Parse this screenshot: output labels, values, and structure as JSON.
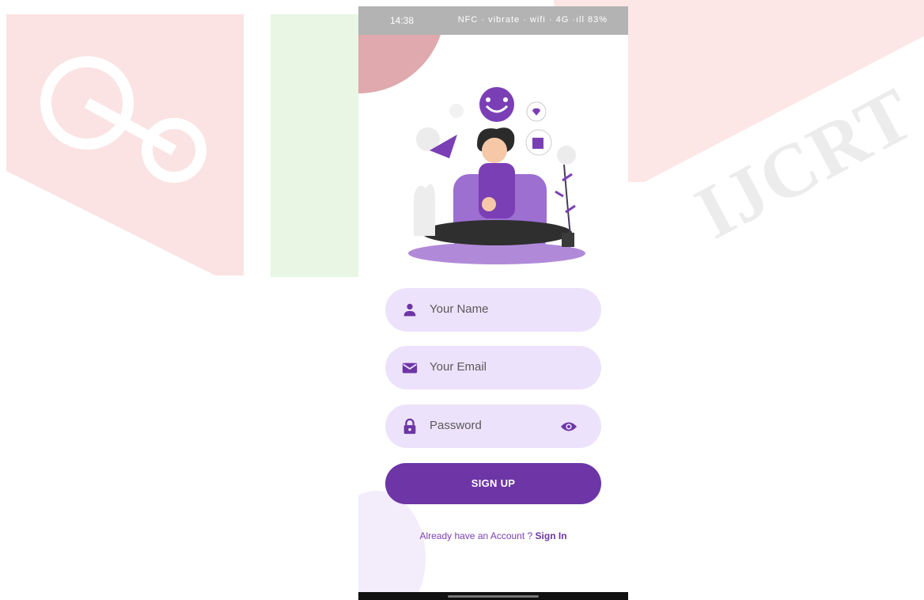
{
  "status_bar": {
    "time": "14:38",
    "icons_text": "NFC · vibrate · wifi · 4G ·ıll ",
    "battery": "83%"
  },
  "watermark": {
    "text": "IJCRT"
  },
  "form": {
    "name_placeholder": "Your Name",
    "email_placeholder": "Your Email",
    "password_placeholder": "Password"
  },
  "sign_up_label": "SIGN UP",
  "footer": {
    "prompt": "Already have an Account ? ",
    "link": "Sign In"
  },
  "colors": {
    "primary": "#6d35a6",
    "field_bg": "#ede2fb",
    "text_link": "#7b3fb5"
  },
  "icons": [
    "person-icon",
    "mail-icon",
    "lock-icon",
    "eye-icon"
  ]
}
